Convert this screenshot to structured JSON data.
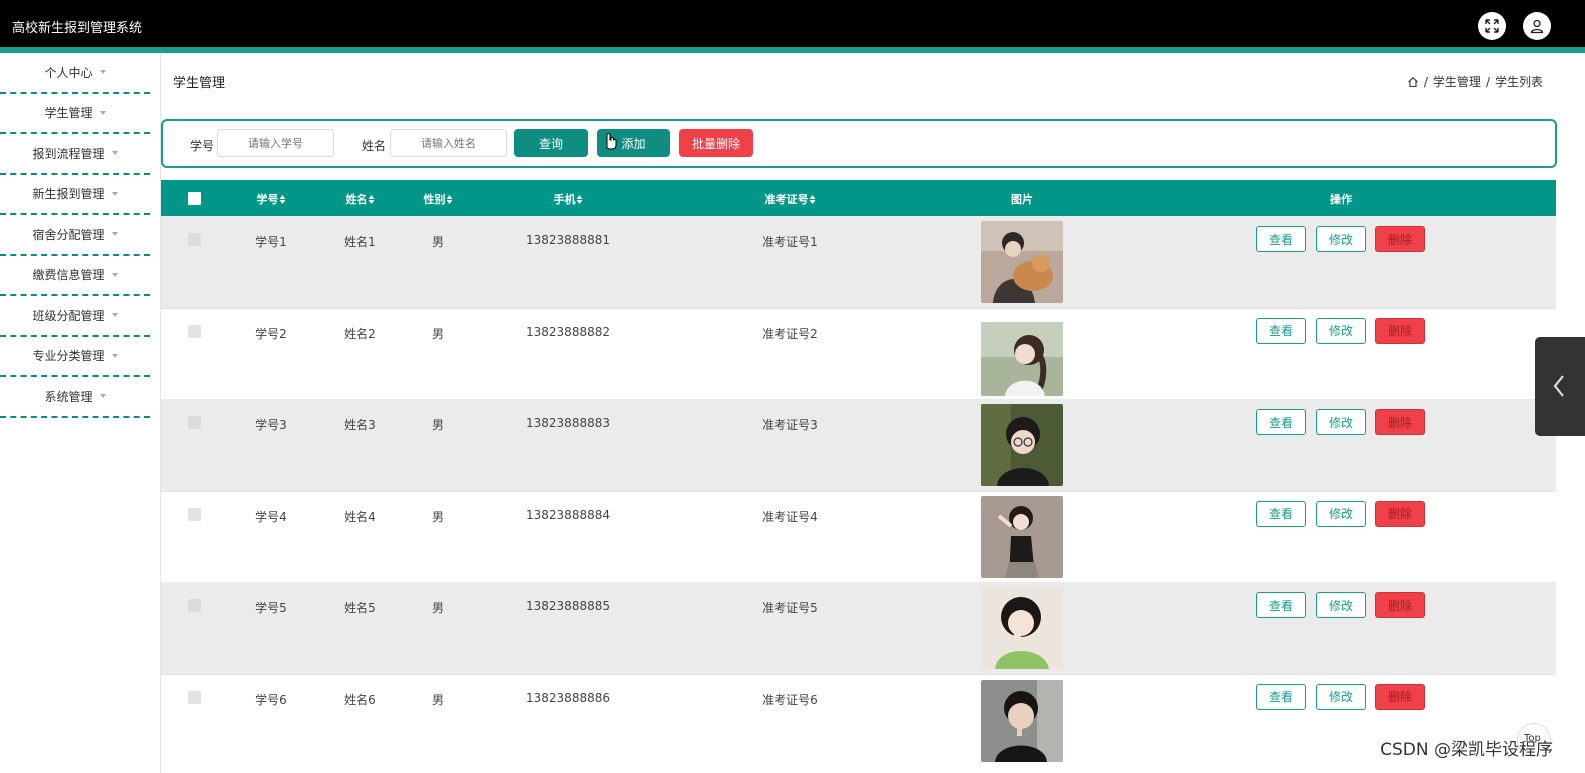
{
  "app": {
    "title": "高校新生报到管理系统"
  },
  "header": {
    "icons": [
      "fullscreen-icon",
      "user-icon"
    ],
    "accent_color": "#1a9b8c"
  },
  "sidebar": {
    "items": [
      {
        "label": "个人中心"
      },
      {
        "label": "学生管理"
      },
      {
        "label": "报到流程管理"
      },
      {
        "label": "新生报到管理"
      },
      {
        "label": "宿舍分配管理"
      },
      {
        "label": "缴费信息管理"
      },
      {
        "label": "班级分配管理"
      },
      {
        "label": "专业分类管理"
      },
      {
        "label": "系统管理"
      }
    ]
  },
  "page": {
    "title": "学生管理",
    "breadcrumb": {
      "sep1": "/",
      "section": "学生管理",
      "sep2": "/",
      "current": "学生列表"
    }
  },
  "search": {
    "student_no_label": "学号",
    "student_no_placeholder": "请输入学号",
    "name_label": "姓名",
    "name_placeholder": "请输入姓名",
    "query_label": "查询",
    "add_label": "添加",
    "batch_delete_label": "批量删除"
  },
  "table": {
    "columns": {
      "student_no": "学号",
      "name": "姓名",
      "gender": "性别",
      "phone": "手机",
      "exam_no": "准考证号",
      "photo": "图片",
      "actions": "操作"
    },
    "action_labels": {
      "view": "查看",
      "edit": "修改",
      "delete": "删除"
    },
    "header_color": "#009688",
    "rows": [
      {
        "student_no": "学号1",
        "name": "姓名1",
        "gender": "男",
        "phone": "13823888881",
        "exam_no": "准考证号1"
      },
      {
        "student_no": "学号2",
        "name": "姓名2",
        "gender": "男",
        "phone": "13823888882",
        "exam_no": "准考证号2"
      },
      {
        "student_no": "学号3",
        "name": "姓名3",
        "gender": "男",
        "phone": "13823888883",
        "exam_no": "准考证号3"
      },
      {
        "student_no": "学号4",
        "name": "姓名4",
        "gender": "男",
        "phone": "13823888884",
        "exam_no": "准考证号4"
      },
      {
        "student_no": "学号5",
        "name": "姓名5",
        "gender": "男",
        "phone": "13823888885",
        "exam_no": "准考证号5"
      },
      {
        "student_no": "学号6",
        "name": "姓名6",
        "gender": "男",
        "phone": "13823888886",
        "exam_no": "准考证号6"
      }
    ]
  },
  "back_to_top": {
    "label": "Top"
  },
  "watermark": "CSDN @梁凯毕设程序"
}
